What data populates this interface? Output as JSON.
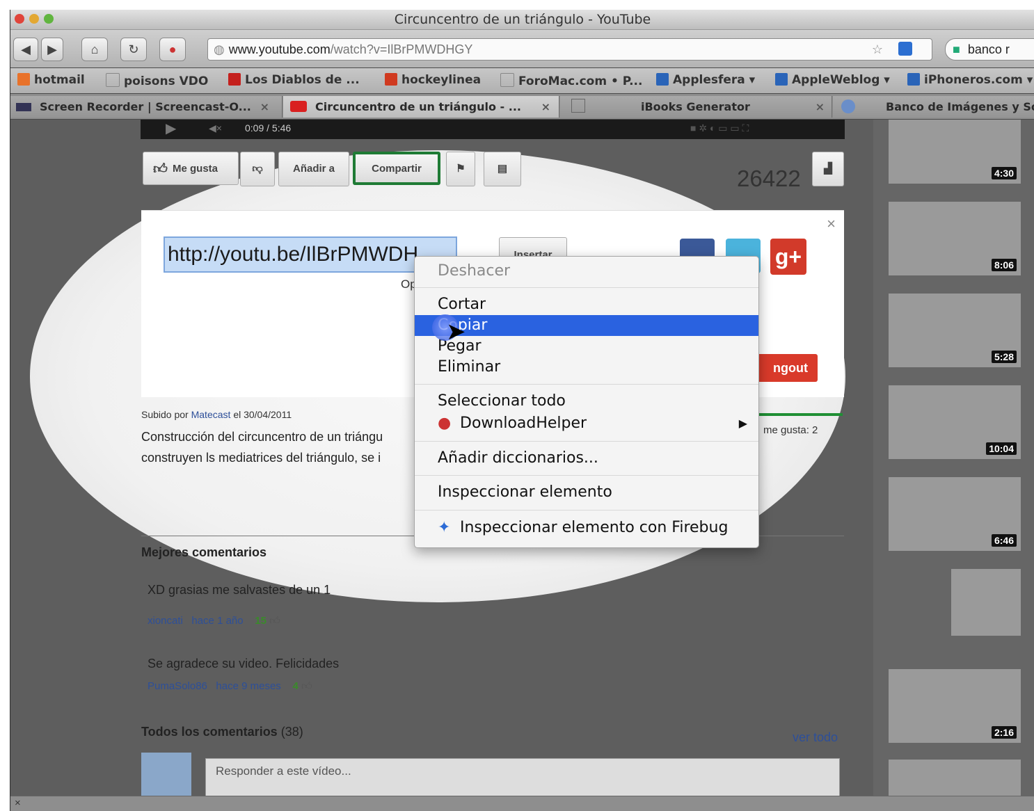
{
  "window": {
    "title": "Circuncentro de un triángulo - YouTube"
  },
  "nav": {
    "url_domain": "www.youtube.com",
    "url_path": "/watch?v=IlBrPMWDHGY",
    "search_text": "banco r"
  },
  "bookmarks": [
    "hotmail",
    "poisons VDO",
    "Los Diablos de ...",
    "hockeylinea",
    "ForoMac.com • P...",
    "Applesfera ▾",
    "AppleWeblog ▾",
    "iPhoneros.com ▾"
  ],
  "tabs": [
    {
      "label": "Screen Recorder | Screencast-O..."
    },
    {
      "label": "Circuncentro de un triángulo - ..."
    },
    {
      "label": "iBooks Generator"
    },
    {
      "label": "Banco de Imágenes y Son"
    }
  ],
  "player": {
    "time": "0:09 / 5:46"
  },
  "actions": {
    "like": "Me gusta",
    "add_to": "Añadir a",
    "share": "Compartir",
    "views": "26422"
  },
  "share": {
    "url": "http://youtu.be/IlBrPMWDH",
    "embed": "Insertar",
    "options_stub": "Op",
    "hangout_stub": "ngout"
  },
  "context_menu": {
    "items": [
      "Deshacer",
      "Cortar",
      "Copiar",
      "Pegar",
      "Eliminar",
      "Seleccionar todo",
      "DownloadHelper",
      "Añadir diccionarios...",
      "Inspeccionar elemento",
      "Inspeccionar elemento con Firebug"
    ],
    "highlight_color": "#2a62e0"
  },
  "upload": {
    "prefix": "Subido por",
    "user": "Matecast",
    "date": "el 30/04/2011",
    "likes": "me gusta: 2"
  },
  "description": [
    "Construcción del circuncentro de un triángu",
    "construyen ls mediatrices del triángulo, se i"
  ],
  "top_comments": {
    "heading": "Mejores comentarios",
    "items": [
      {
        "text": "XD grasias me salvastes de un 1",
        "user": "xioncati",
        "time": "hace 1 año",
        "likes": "15"
      },
      {
        "text": "Se agradece su video. Felicidades",
        "user": "PumaSolo86",
        "time": "hace 9 meses",
        "likes": "4"
      }
    ]
  },
  "all_comments": {
    "heading": "Todos los comentarios",
    "count": "(38)",
    "see_all": "ver todo",
    "reply_placeholder": "Responder a este vídeo..."
  },
  "sidebar_durations": [
    "4:30",
    "8:06",
    "5:28",
    "10:04",
    "6:46",
    "2:16"
  ]
}
